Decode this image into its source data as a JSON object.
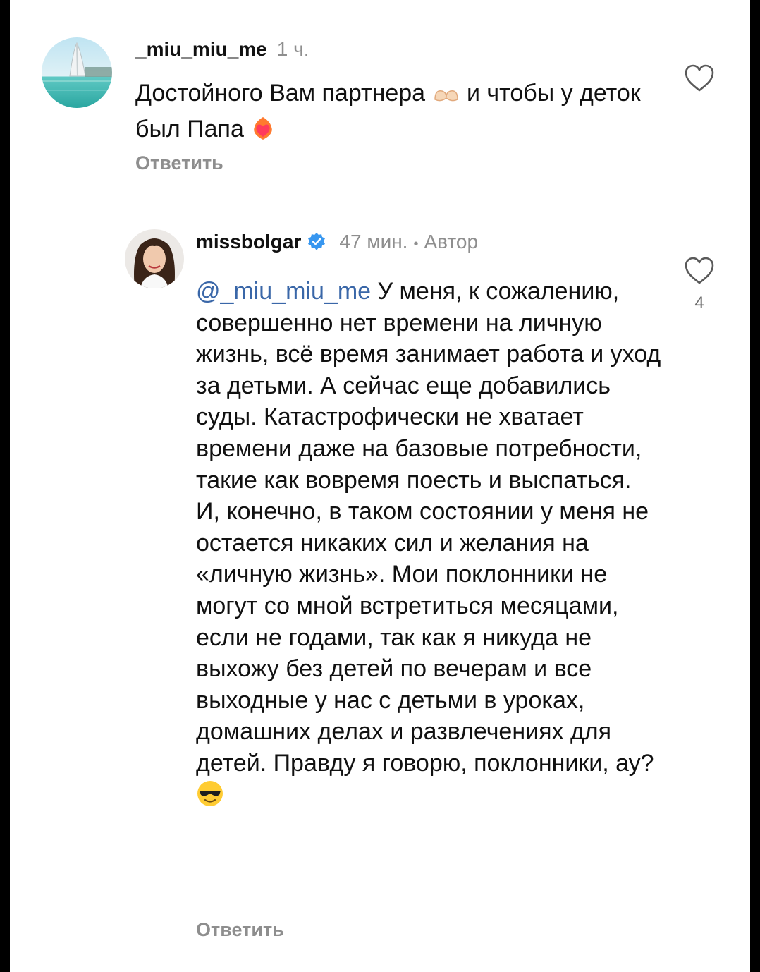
{
  "comments": [
    {
      "username": "_miu_miu_me",
      "time": "1 ч.",
      "text_part1": "Достойного Вам партнера",
      "emoji1": "heart-hands-emoji",
      "text_part2": "и чтобы у деток был Папа",
      "emoji2": "heart-on-fire-emoji",
      "reply_label": "Ответить",
      "avatar": "burj-al-arab-beach-photo"
    },
    {
      "username": "missbolgar",
      "verified": true,
      "time": "47 мин.",
      "separator": "•",
      "author_label": "Автор",
      "mention": "@_miu_miu_me",
      "text": "У меня, к сожалению, совершенно нет времени на личную жизнь, всё время занимает работа и уход за детьми. А сейчас еще добавились суды. Катастрофически не хватает времени даже на базовые потребности, такие как вовремя поесть и выспаться. И, конечно, в таком состоянии у меня не остается никаких сил и желания на «личную жизнь». Мои поклонники не могут со мной встретиться месяцами, если не годами, так как я никуда не выхожу без детей по вечерам и все выходные у нас с детьми в уроках, домашних делах и развлечениях для детей. Правду я говорю, поклонники, ау?",
      "emoji": "sunglasses-emoji",
      "reply_label": "Ответить",
      "like_count": "4",
      "avatar": "woman-portrait-photo"
    }
  ],
  "colors": {
    "background": "#ffffff",
    "frame": "#000000",
    "mention": "#3a67a8",
    "secondary_text": "#8e8e8e",
    "verified_badge": "#3897f0"
  }
}
